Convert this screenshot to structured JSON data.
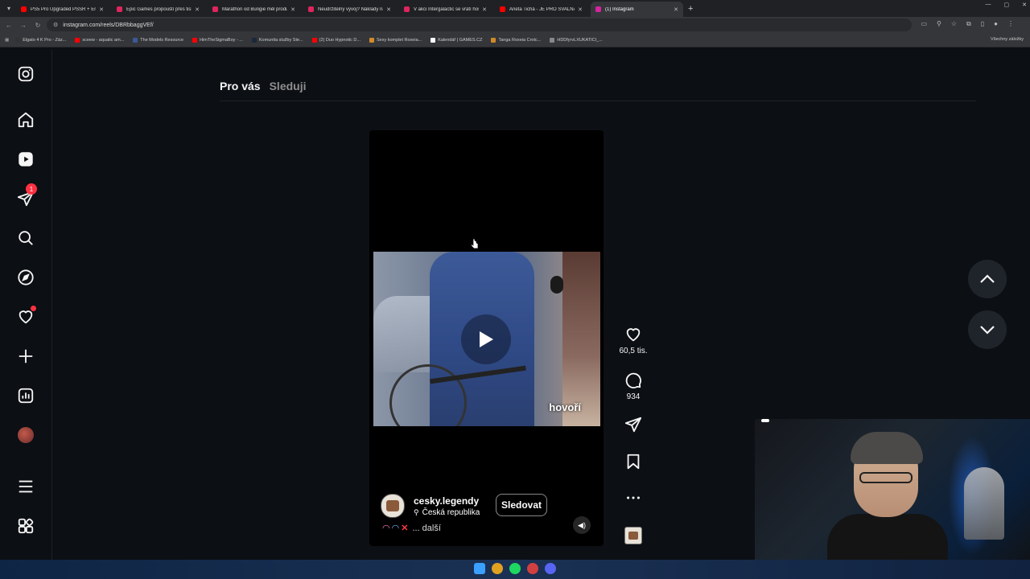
{
  "browser": {
    "tabs": [
      {
        "title": "PS5 Pro Upgraded PSSR + Enh...",
        "color": "#ff0000",
        "active": false
      },
      {
        "title": "Epic Games propouští přes tisíc...",
        "color": "#e0245e",
        "active": false
      },
      {
        "title": "Marathon od Bungie měl produ...",
        "color": "#e0245e",
        "active": false
      },
      {
        "title": "Neudržitelný vývoj? Náklady na...",
        "color": "#e0245e",
        "active": false
      },
      {
        "title": "V akci Intergalactic se vrátí hosté...",
        "color": "#e0245e",
        "active": false
      },
      {
        "title": "Aneta Tichá - JE PRO SVALNAT...",
        "color": "#ff0000",
        "active": false
      },
      {
        "title": "(1) Instagram",
        "color": "#d6249f",
        "active": true
      }
    ],
    "url": "instagram.com/reels/DBRbbaggVEf/",
    "bookmarks": [
      {
        "label": "Elgato 4 K Pro - Záz...",
        "color": "#333333"
      },
      {
        "label": "sceew - aquatic am...",
        "color": "#ff0000"
      },
      {
        "label": "The Models Resource",
        "color": "#3b5998"
      },
      {
        "label": "HimTheSigmaBoy - ...",
        "color": "#ff0000"
      },
      {
        "label": "Komunita služby Ste...",
        "color": "#1b2838"
      },
      {
        "label": "(2) Duo Hypnotic D...",
        "color": "#ff0000"
      },
      {
        "label": "Sexy komplet Roxeia...",
        "color": "#d08a2a"
      },
      {
        "label": "Kalendář | GAMES.CZ",
        "color": "#ffffff"
      },
      {
        "label": "Tanga Roxeia Crotc...",
        "color": "#d08a2a"
      },
      {
        "label": "HDDfyrvLXUKATICI_...",
        "color": "#888888"
      }
    ],
    "bookmarks_right": "Všechny záložky"
  },
  "sidebar": {
    "notification_count": "1"
  },
  "feed": {
    "tab_for_you": "Pro vás",
    "tab_following": "Sleduji"
  },
  "reel": {
    "caption_overlay": "hovoří",
    "owner_name": "cesky.legendy",
    "location": "Česká republika",
    "follow_label": "Sledovat",
    "description_more": "... další",
    "likes": "60,5 tis.",
    "comments": "934"
  }
}
